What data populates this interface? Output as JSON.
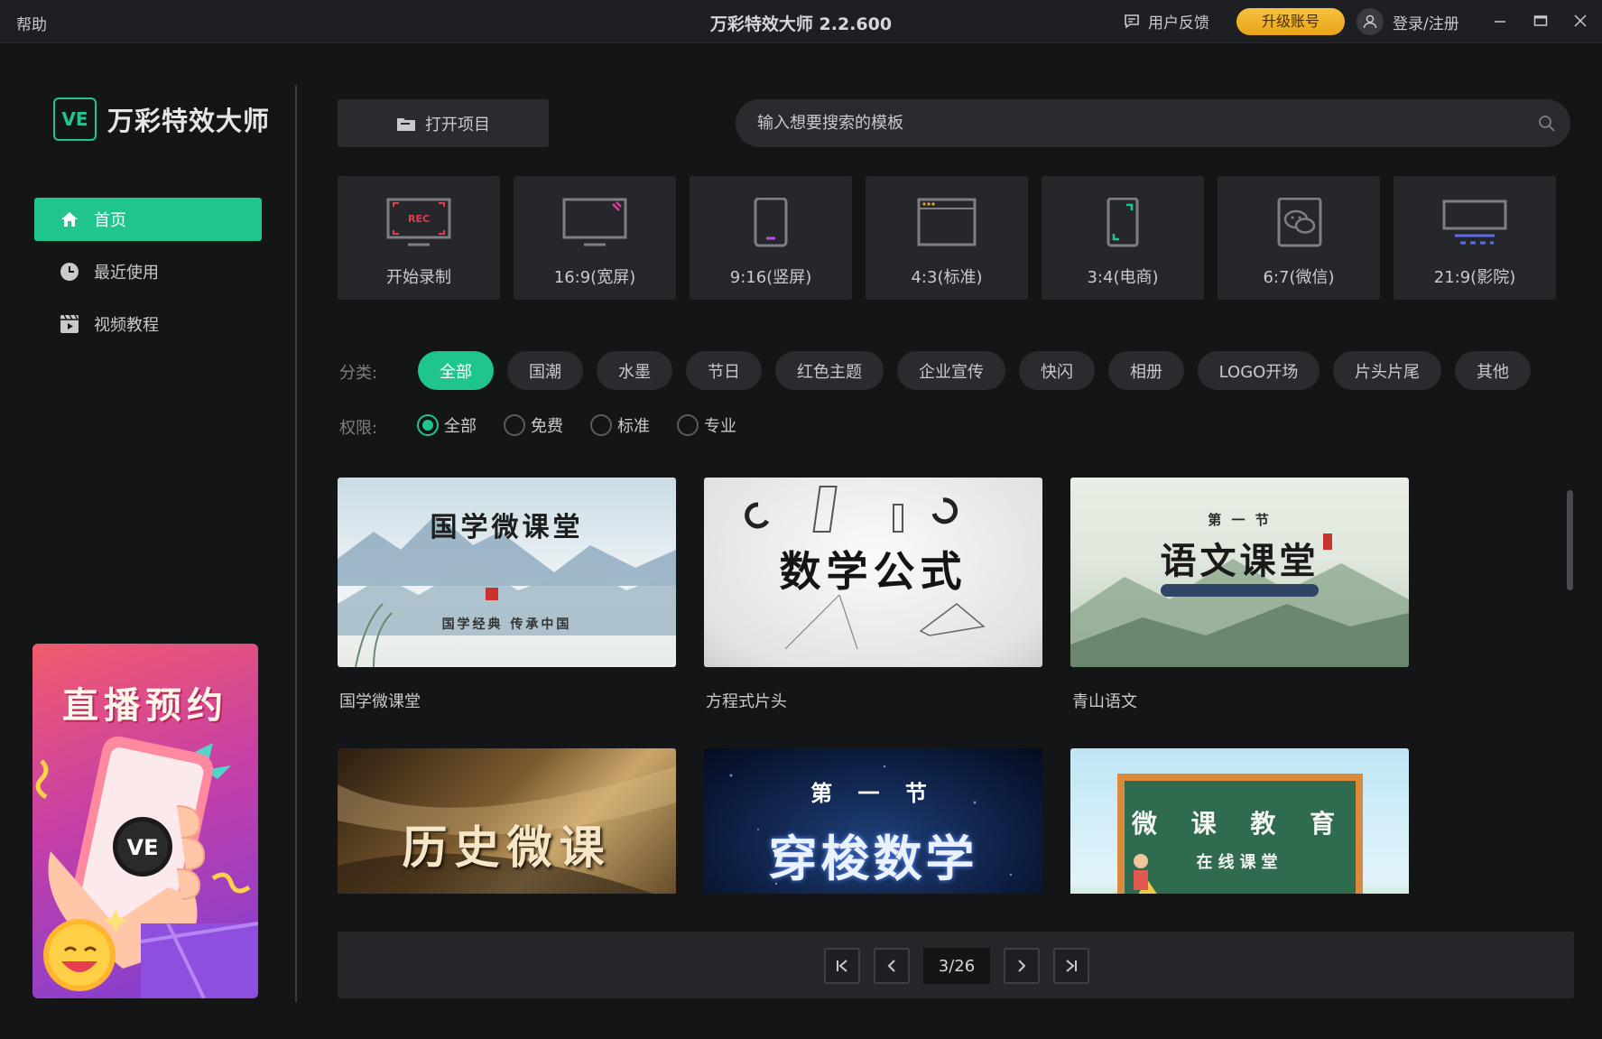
{
  "window": {
    "help": "帮助",
    "title": "万彩特效大师 2.2.600",
    "feedback": "用户反馈",
    "upgrade": "升级账号",
    "login": "登录/注册"
  },
  "sidebar": {
    "logo_mark": "VE",
    "logo_text": "万彩特效大师",
    "items": [
      {
        "label": "首页",
        "icon": "home-icon",
        "active": true
      },
      {
        "label": "最近使用",
        "icon": "clock-icon",
        "active": false
      },
      {
        "label": "视频教程",
        "icon": "video-tutorial-icon",
        "active": false
      }
    ],
    "promo": {
      "title": "直播预约",
      "badge": "VE"
    }
  },
  "toolbar": {
    "open_project": "打开项目",
    "search_placeholder": "输入想要搜索的模板"
  },
  "ratios": [
    {
      "label": "开始录制",
      "icon": "record-icon"
    },
    {
      "label": "16:9(宽屏)",
      "icon": "widescreen-icon"
    },
    {
      "label": "9:16(竖屏)",
      "icon": "portrait-phone-icon"
    },
    {
      "label": "4:3(标准)",
      "icon": "standard-window-icon"
    },
    {
      "label": "3:4(电商)",
      "icon": "ecommerce-phone-icon"
    },
    {
      "label": "6:7(微信)",
      "icon": "wechat-icon"
    },
    {
      "label": "21:9(影院)",
      "icon": "cinema-screen-icon"
    }
  ],
  "filters": {
    "category_label": "分类:",
    "categories": [
      "全部",
      "国潮",
      "水墨",
      "节日",
      "红色主题",
      "企业宣传",
      "快闪",
      "相册",
      "LOGO开场",
      "片头片尾",
      "其他"
    ],
    "active_category": "全部",
    "permission_label": "权限:",
    "permissions": [
      "全部",
      "免费",
      "标准",
      "专业"
    ],
    "active_permission": "全部"
  },
  "templates": [
    {
      "name": "国学微课堂",
      "thumb_text": "国学微课堂",
      "thumb_sub": "国学经典 传承中国"
    },
    {
      "name": "方程式片头",
      "thumb_text": "数学公式",
      "thumb_sub": ""
    },
    {
      "name": "青山语文",
      "thumb_text": "语文课堂",
      "thumb_sub": "第 一 节"
    },
    {
      "name": "",
      "thumb_text": "历史微课",
      "thumb_sub": ""
    },
    {
      "name": "",
      "thumb_text": "穿梭数学",
      "thumb_sub": "第 一 节"
    },
    {
      "name": "",
      "thumb_text": "微 课 教 育",
      "thumb_sub": "在线课堂"
    }
  ],
  "pagination": {
    "current": "3/26"
  },
  "colors": {
    "accent": "#1fc58c",
    "upgrade": "#f0b52d",
    "background": "#141517"
  }
}
